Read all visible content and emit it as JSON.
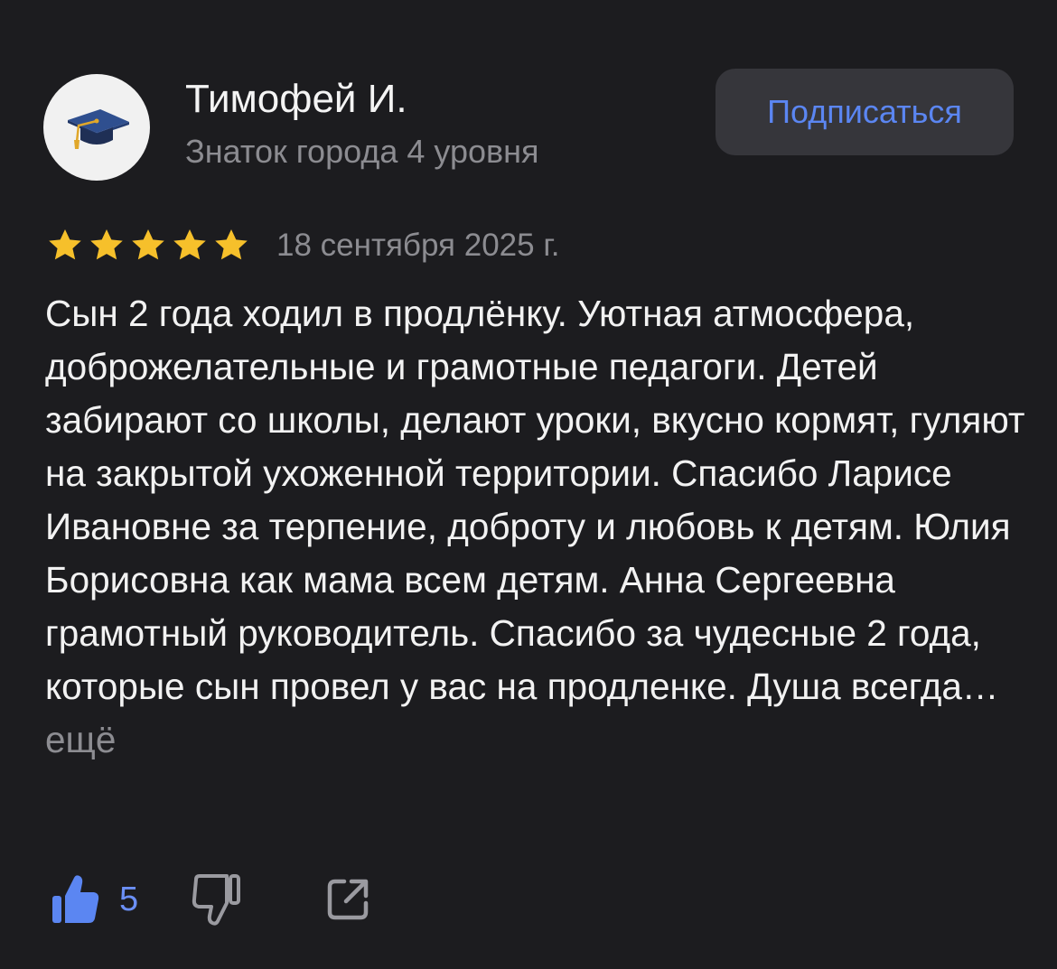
{
  "author": {
    "name": "Тимофей И.",
    "level": "Знаток города 4 уровня",
    "avatar_icon": "graduation-cap-icon"
  },
  "subscribe": {
    "label": "Подписаться"
  },
  "review": {
    "rating": 5,
    "rating_max": 5,
    "date": "18 сентября 2025 г.",
    "text": "Сын 2 года ходил в продлёнку. Уютная атмосфера, доброжелательные и грамотные педагоги. Детей забирают со школы, делают уроки, вкусно кормят, гуляют на закрытой ухоженной территории. Спасибо Ларисе Ивановне за терпение, доброту и любовь к детям. Юлия Борисовна как мама всем детям. Анна Сергеевна грамотный руководитель. Спасибо за чудесные 2 года, которые сын провел у вас на продленке. Душа всегда…",
    "more_label": "ещё"
  },
  "actions": {
    "like_count": "5",
    "like_icon": "thumbs-up-icon",
    "dislike_icon": "thumbs-down-icon",
    "share_icon": "share-icon"
  },
  "colors": {
    "background": "#1c1c1f",
    "accent": "#5b86f2",
    "star": "#f6c02b",
    "muted": "#8c8c91"
  }
}
